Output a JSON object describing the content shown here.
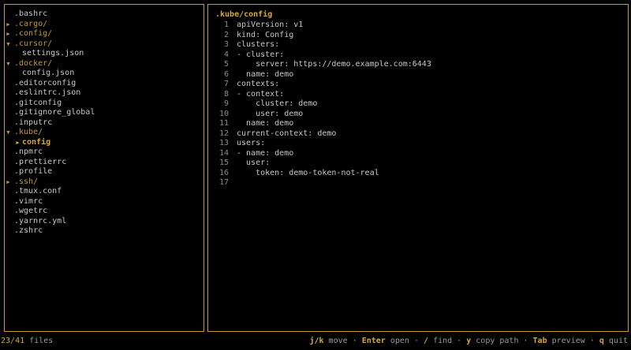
{
  "tree": {
    "items": [
      {
        "name": ".bashrc",
        "type": "file",
        "depth": 0,
        "expanded": false,
        "selected": false
      },
      {
        "name": ".cargo/",
        "type": "dir",
        "depth": 0,
        "expanded": false,
        "selected": false
      },
      {
        "name": ".config/",
        "type": "dir",
        "depth": 0,
        "expanded": false,
        "selected": false
      },
      {
        "name": ".cursor/",
        "type": "dir",
        "depth": 0,
        "expanded": true,
        "selected": false
      },
      {
        "name": "settings.json",
        "type": "file",
        "depth": 1,
        "expanded": false,
        "selected": false
      },
      {
        "name": ".docker/",
        "type": "dir",
        "depth": 0,
        "expanded": true,
        "selected": false
      },
      {
        "name": "config.json",
        "type": "file",
        "depth": 1,
        "expanded": false,
        "selected": false
      },
      {
        "name": ".editorconfig",
        "type": "file",
        "depth": 0,
        "expanded": false,
        "selected": false
      },
      {
        "name": ".eslintrc.json",
        "type": "file",
        "depth": 0,
        "expanded": false,
        "selected": false
      },
      {
        "name": ".gitconfig",
        "type": "file",
        "depth": 0,
        "expanded": false,
        "selected": false
      },
      {
        "name": ".gitignore_global",
        "type": "file",
        "depth": 0,
        "expanded": false,
        "selected": false
      },
      {
        "name": ".inputrc",
        "type": "file",
        "depth": 0,
        "expanded": false,
        "selected": false
      },
      {
        "name": ".kube/",
        "type": "dir",
        "depth": 0,
        "expanded": true,
        "selected": false
      },
      {
        "name": "config",
        "type": "file",
        "depth": 1,
        "expanded": false,
        "selected": true
      },
      {
        "name": ".npmrc",
        "type": "file",
        "depth": 0,
        "expanded": false,
        "selected": false
      },
      {
        "name": ".prettierrc",
        "type": "file",
        "depth": 0,
        "expanded": false,
        "selected": false
      },
      {
        "name": ".profile",
        "type": "file",
        "depth": 0,
        "expanded": false,
        "selected": false
      },
      {
        "name": ".ssh/",
        "type": "dir",
        "depth": 0,
        "expanded": false,
        "selected": false
      },
      {
        "name": ".tmux.conf",
        "type": "file",
        "depth": 0,
        "expanded": false,
        "selected": false
      },
      {
        "name": ".vimrc",
        "type": "file",
        "depth": 0,
        "expanded": false,
        "selected": false
      },
      {
        "name": ".wgetrc",
        "type": "file",
        "depth": 0,
        "expanded": false,
        "selected": false
      },
      {
        "name": ".yarnrc.yml",
        "type": "file",
        "depth": 0,
        "expanded": false,
        "selected": false
      },
      {
        "name": ".zshrc",
        "type": "file",
        "depth": 0,
        "expanded": false,
        "selected": false
      }
    ],
    "markers": {
      "collapsed": "▶",
      "expanded": "▼",
      "selected": "▶"
    }
  },
  "preview": {
    "title": ".kube/config",
    "lines": [
      "apiVersion: v1",
      "kind: Config",
      "clusters:",
      "- cluster:",
      "    server: https://demo.example.com:6443",
      "  name: demo",
      "contexts:",
      "- context:",
      "    cluster: demo",
      "    user: demo",
      "  name: demo",
      "current-context: demo",
      "users:",
      "- name: demo",
      "  user:",
      "    token: demo-token-not-real",
      ""
    ]
  },
  "status": {
    "current": "23",
    "separator": "/",
    "total": "41",
    "label": " files",
    "hints": [
      {
        "key": "j/k",
        "action": "move"
      },
      {
        "key": "Enter",
        "action": "open"
      },
      {
        "key": "/",
        "action": "find"
      },
      {
        "key": "y",
        "action": "copy path"
      },
      {
        "key": "Tab",
        "action": "preview"
      },
      {
        "key": "q",
        "action": "quit"
      }
    ],
    "hint_separator": " · "
  },
  "colors": {
    "accent": "#c49b2e",
    "text": "#c8c8c8",
    "muted": "#8a8a8a",
    "background": "#000000"
  }
}
